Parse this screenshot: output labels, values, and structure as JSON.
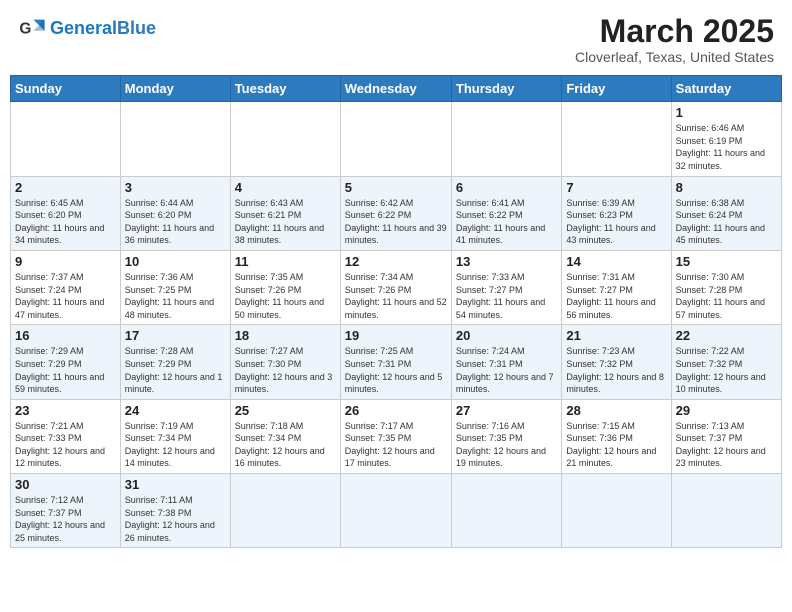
{
  "header": {
    "logo_general": "General",
    "logo_blue": "Blue",
    "month_title": "March 2025",
    "location": "Cloverleaf, Texas, United States"
  },
  "days_of_week": [
    "Sunday",
    "Monday",
    "Tuesday",
    "Wednesday",
    "Thursday",
    "Friday",
    "Saturday"
  ],
  "weeks": [
    [
      null,
      null,
      null,
      null,
      null,
      null,
      {
        "day": "1",
        "sunrise": "Sunrise: 6:46 AM",
        "sunset": "Sunset: 6:19 PM",
        "daylight": "Daylight: 11 hours and 32 minutes."
      }
    ],
    [
      {
        "day": "2",
        "sunrise": "Sunrise: 6:45 AM",
        "sunset": "Sunset: 6:20 PM",
        "daylight": "Daylight: 11 hours and 34 minutes."
      },
      {
        "day": "3",
        "sunrise": "Sunrise: 6:44 AM",
        "sunset": "Sunset: 6:20 PM",
        "daylight": "Daylight: 11 hours and 36 minutes."
      },
      {
        "day": "4",
        "sunrise": "Sunrise: 6:43 AM",
        "sunset": "Sunset: 6:21 PM",
        "daylight": "Daylight: 11 hours and 38 minutes."
      },
      {
        "day": "5",
        "sunrise": "Sunrise: 6:42 AM",
        "sunset": "Sunset: 6:22 PM",
        "daylight": "Daylight: 11 hours and 39 minutes."
      },
      {
        "day": "6",
        "sunrise": "Sunrise: 6:41 AM",
        "sunset": "Sunset: 6:22 PM",
        "daylight": "Daylight: 11 hours and 41 minutes."
      },
      {
        "day": "7",
        "sunrise": "Sunrise: 6:39 AM",
        "sunset": "Sunset: 6:23 PM",
        "daylight": "Daylight: 11 hours and 43 minutes."
      },
      {
        "day": "8",
        "sunrise": "Sunrise: 6:38 AM",
        "sunset": "Sunset: 6:24 PM",
        "daylight": "Daylight: 11 hours and 45 minutes."
      }
    ],
    [
      {
        "day": "9",
        "sunrise": "Sunrise: 7:37 AM",
        "sunset": "Sunset: 7:24 PM",
        "daylight": "Daylight: 11 hours and 47 minutes."
      },
      {
        "day": "10",
        "sunrise": "Sunrise: 7:36 AM",
        "sunset": "Sunset: 7:25 PM",
        "daylight": "Daylight: 11 hours and 48 minutes."
      },
      {
        "day": "11",
        "sunrise": "Sunrise: 7:35 AM",
        "sunset": "Sunset: 7:26 PM",
        "daylight": "Daylight: 11 hours and 50 minutes."
      },
      {
        "day": "12",
        "sunrise": "Sunrise: 7:34 AM",
        "sunset": "Sunset: 7:26 PM",
        "daylight": "Daylight: 11 hours and 52 minutes."
      },
      {
        "day": "13",
        "sunrise": "Sunrise: 7:33 AM",
        "sunset": "Sunset: 7:27 PM",
        "daylight": "Daylight: 11 hours and 54 minutes."
      },
      {
        "day": "14",
        "sunrise": "Sunrise: 7:31 AM",
        "sunset": "Sunset: 7:27 PM",
        "daylight": "Daylight: 11 hours and 56 minutes."
      },
      {
        "day": "15",
        "sunrise": "Sunrise: 7:30 AM",
        "sunset": "Sunset: 7:28 PM",
        "daylight": "Daylight: 11 hours and 57 minutes."
      }
    ],
    [
      {
        "day": "16",
        "sunrise": "Sunrise: 7:29 AM",
        "sunset": "Sunset: 7:29 PM",
        "daylight": "Daylight: 11 hours and 59 minutes."
      },
      {
        "day": "17",
        "sunrise": "Sunrise: 7:28 AM",
        "sunset": "Sunset: 7:29 PM",
        "daylight": "Daylight: 12 hours and 1 minute."
      },
      {
        "day": "18",
        "sunrise": "Sunrise: 7:27 AM",
        "sunset": "Sunset: 7:30 PM",
        "daylight": "Daylight: 12 hours and 3 minutes."
      },
      {
        "day": "19",
        "sunrise": "Sunrise: 7:25 AM",
        "sunset": "Sunset: 7:31 PM",
        "daylight": "Daylight: 12 hours and 5 minutes."
      },
      {
        "day": "20",
        "sunrise": "Sunrise: 7:24 AM",
        "sunset": "Sunset: 7:31 PM",
        "daylight": "Daylight: 12 hours and 7 minutes."
      },
      {
        "day": "21",
        "sunrise": "Sunrise: 7:23 AM",
        "sunset": "Sunset: 7:32 PM",
        "daylight": "Daylight: 12 hours and 8 minutes."
      },
      {
        "day": "22",
        "sunrise": "Sunrise: 7:22 AM",
        "sunset": "Sunset: 7:32 PM",
        "daylight": "Daylight: 12 hours and 10 minutes."
      }
    ],
    [
      {
        "day": "23",
        "sunrise": "Sunrise: 7:21 AM",
        "sunset": "Sunset: 7:33 PM",
        "daylight": "Daylight: 12 hours and 12 minutes."
      },
      {
        "day": "24",
        "sunrise": "Sunrise: 7:19 AM",
        "sunset": "Sunset: 7:34 PM",
        "daylight": "Daylight: 12 hours and 14 minutes."
      },
      {
        "day": "25",
        "sunrise": "Sunrise: 7:18 AM",
        "sunset": "Sunset: 7:34 PM",
        "daylight": "Daylight: 12 hours and 16 minutes."
      },
      {
        "day": "26",
        "sunrise": "Sunrise: 7:17 AM",
        "sunset": "Sunset: 7:35 PM",
        "daylight": "Daylight: 12 hours and 17 minutes."
      },
      {
        "day": "27",
        "sunrise": "Sunrise: 7:16 AM",
        "sunset": "Sunset: 7:35 PM",
        "daylight": "Daylight: 12 hours and 19 minutes."
      },
      {
        "day": "28",
        "sunrise": "Sunrise: 7:15 AM",
        "sunset": "Sunset: 7:36 PM",
        "daylight": "Daylight: 12 hours and 21 minutes."
      },
      {
        "day": "29",
        "sunrise": "Sunrise: 7:13 AM",
        "sunset": "Sunset: 7:37 PM",
        "daylight": "Daylight: 12 hours and 23 minutes."
      }
    ],
    [
      {
        "day": "30",
        "sunrise": "Sunrise: 7:12 AM",
        "sunset": "Sunset: 7:37 PM",
        "daylight": "Daylight: 12 hours and 25 minutes."
      },
      {
        "day": "31",
        "sunrise": "Sunrise: 7:11 AM",
        "sunset": "Sunset: 7:38 PM",
        "daylight": "Daylight: 12 hours and 26 minutes."
      },
      null,
      null,
      null,
      null,
      null
    ]
  ]
}
